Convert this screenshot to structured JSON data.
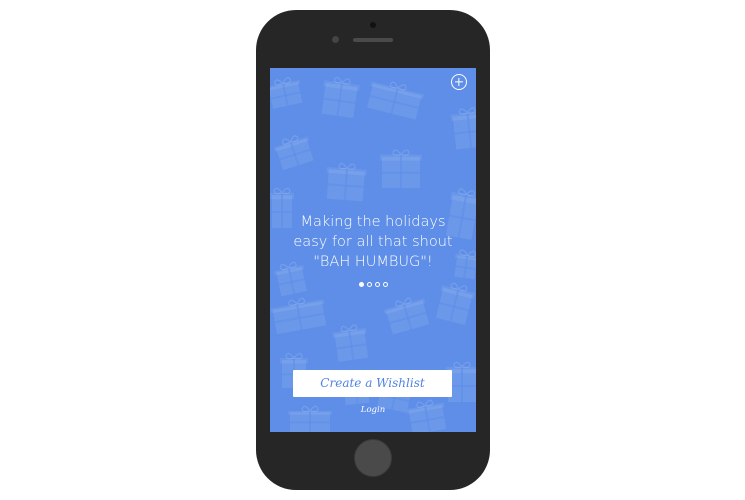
{
  "onboarding": {
    "tagline_lines": [
      "Making the holidays",
      "easy for all that shout",
      "\"BAH HUMBUG\"!"
    ],
    "carousel": {
      "total_pages": 4,
      "active_page": 1
    },
    "create_button_label": "Create a Wishlist",
    "login_label": "Login"
  },
  "icons": {
    "header_action": "add-icon",
    "background": "gift-box-icon"
  },
  "colors": {
    "screen_background": "#5e8ee8",
    "button_text": "#4f82e3",
    "phone_body": "#262626"
  }
}
